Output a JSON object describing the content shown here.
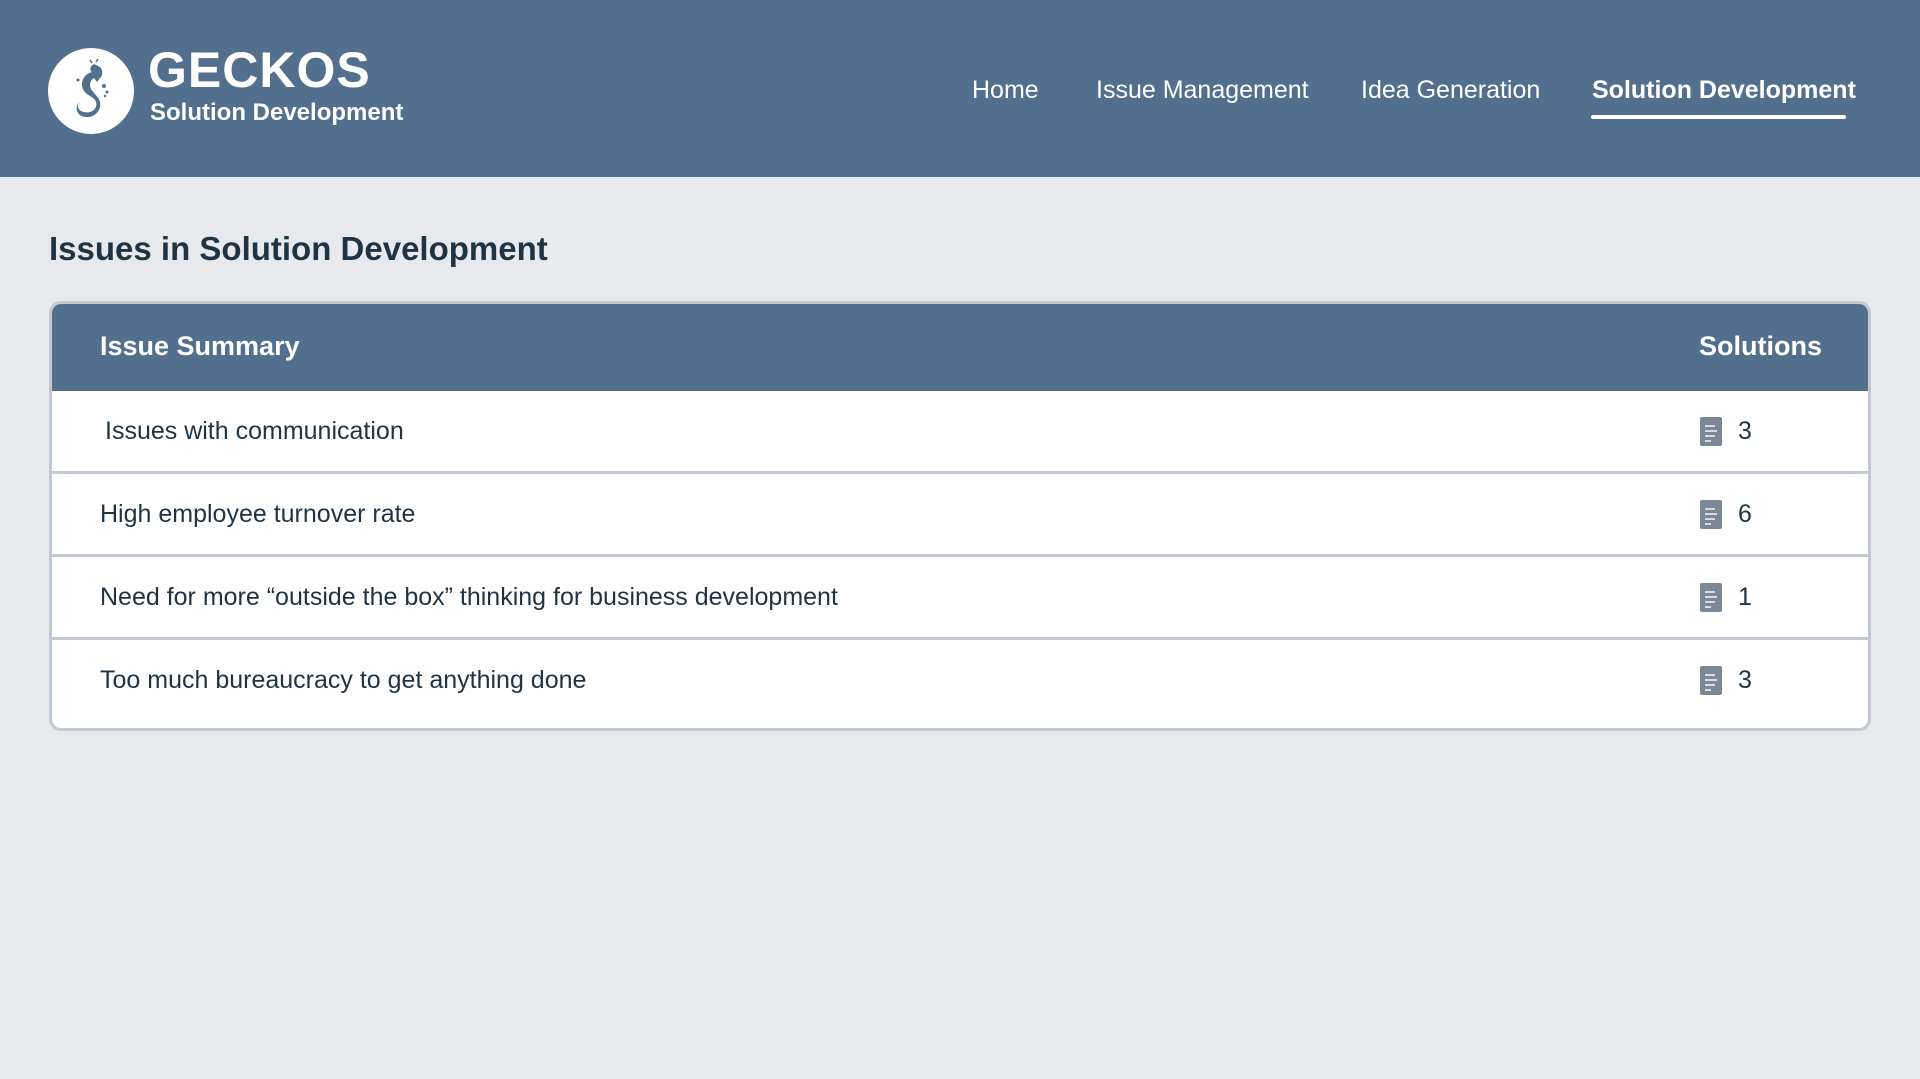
{
  "brand": {
    "name": "GECKOS",
    "subtitle": "Solution Development",
    "logo_icon": "gecko-logo-icon"
  },
  "nav": {
    "items": [
      {
        "label": "Home",
        "active": false
      },
      {
        "label": "Issue Management",
        "active": false
      },
      {
        "label": "Idea Generation",
        "active": false
      },
      {
        "label": "Solution Development",
        "active": true
      }
    ]
  },
  "page": {
    "title": "Issues in Solution Development"
  },
  "table": {
    "headers": {
      "summary": "Issue Summary",
      "solutions": "Solutions"
    },
    "rows": [
      {
        "summary": "Issues with communication",
        "solutions": "3",
        "icon": "document-icon"
      },
      {
        "summary": "High employee turnover rate",
        "solutions": "6",
        "icon": "document-icon"
      },
      {
        "summary": "Need for more “outside the box” thinking for business development",
        "solutions": "1",
        "icon": "document-icon"
      },
      {
        "summary": "Too much bureaucracy to get anything done",
        "solutions": "3",
        "icon": "document-icon"
      }
    ]
  },
  "colors": {
    "header_bg": "#526f8d",
    "page_bg": "#e8e9ed",
    "text": "#1e3445",
    "border": "#c3c9d2"
  }
}
